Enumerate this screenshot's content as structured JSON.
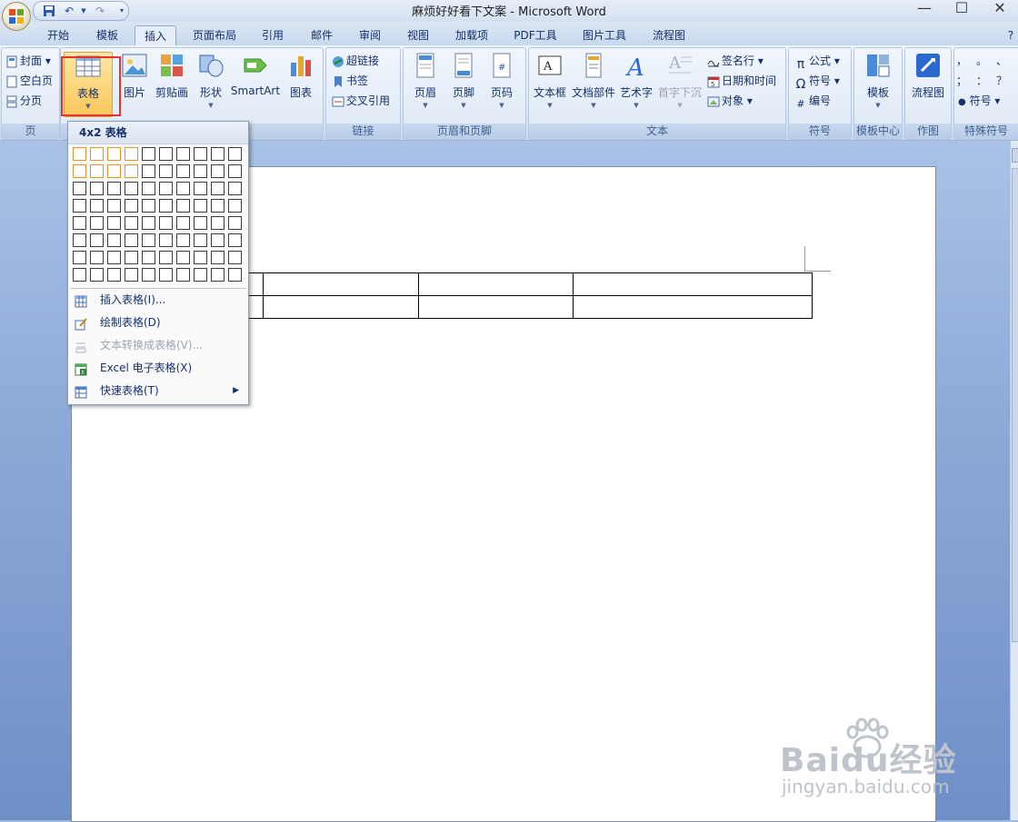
{
  "window": {
    "title": "麻烦好好看下文案 - Microsoft Word",
    "controls": [
      "minimize",
      "maximize",
      "close"
    ]
  },
  "tabs": [
    {
      "label": "开始",
      "active": false
    },
    {
      "label": "模板",
      "active": false
    },
    {
      "label": "插入",
      "active": true
    },
    {
      "label": "页面布局",
      "active": false
    },
    {
      "label": "引用",
      "active": false
    },
    {
      "label": "邮件",
      "active": false
    },
    {
      "label": "审阅",
      "active": false
    },
    {
      "label": "视图",
      "active": false
    },
    {
      "label": "加载项",
      "active": false
    },
    {
      "label": "PDF工具",
      "active": false
    },
    {
      "label": "图片工具",
      "active": false
    },
    {
      "label": "流程图",
      "active": false
    }
  ],
  "ribbon": {
    "pages": {
      "label": "页",
      "items": [
        "封面",
        "空白页",
        "分页"
      ]
    },
    "table": {
      "label": "表格"
    },
    "illustrations": {
      "items": [
        "图片",
        "剪贴画",
        "形状",
        "SmartArt",
        "图表"
      ]
    },
    "links": {
      "label": "链接",
      "items": [
        "超链接",
        "书签",
        "交叉引用"
      ]
    },
    "header_footer": {
      "label": "页眉和页脚",
      "items": [
        "页眉",
        "页脚",
        "页码"
      ]
    },
    "text": {
      "label": "文本",
      "items": [
        "文本框",
        "文档部件",
        "艺术字",
        "首字下沉"
      ],
      "side_items": [
        "签名行",
        "日期和时间",
        "对象"
      ]
    },
    "symbols": {
      "label": "符号",
      "items": [
        "公式",
        "符号",
        "编号"
      ]
    },
    "template_center": {
      "label": "模板中心",
      "button": "模板"
    },
    "drawing": {
      "label": "作图",
      "button": "流程图"
    },
    "special_symbols": {
      "label": "特殊符号",
      "button": "符号",
      "glyphs": [
        "，",
        "。",
        "、",
        "；",
        "：",
        "？"
      ]
    }
  },
  "dropdown": {
    "header": "4x2 表格",
    "grid_cols": 10,
    "grid_rows": 8,
    "selected_cols": 4,
    "selected_rows": 2,
    "items": [
      {
        "label": "插入表格(I)...",
        "enabled": true,
        "icon": "insert-table-icon"
      },
      {
        "label": "绘制表格(D)",
        "enabled": true,
        "icon": "draw-table-icon"
      },
      {
        "label": "文本转换成表格(V)...",
        "enabled": false,
        "icon": "text-to-table-icon"
      },
      {
        "label": "Excel 电子表格(X)",
        "enabled": true,
        "icon": "excel-sheet-icon"
      },
      {
        "label": "快速表格(T)",
        "enabled": true,
        "icon": "quick-table-icon",
        "submenu": true
      }
    ]
  },
  "document": {
    "table_rows": 2,
    "table_cols": 4
  },
  "watermark": {
    "brand": "Baidu经验",
    "url": "jingyan.baidu.com"
  },
  "colors": {
    "accent": "#1d4f9a",
    "highlight": "#e5322d",
    "selection": "#e8912e"
  }
}
